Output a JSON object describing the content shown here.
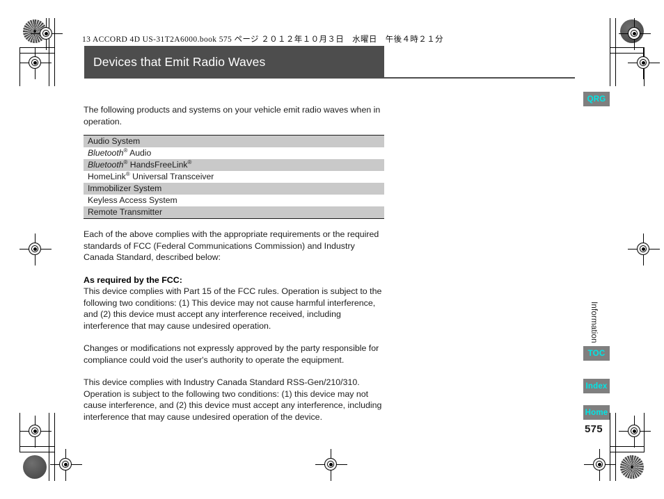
{
  "page": {
    "running_header": "13 ACCORD 4D US-31T2A6000.book  575 ページ  ２０１２年１０月３日　水曜日　午後４時２１分",
    "title": "Devices that Emit Radio Waves",
    "page_number": "575",
    "side_tab": "Information",
    "colors": {
      "title_bar": "#4d4d4d",
      "table_shade": "#c9c9c9",
      "nav_button_bg": "#7f7f7f",
      "nav_button_text": "#00e6e6"
    }
  },
  "body": {
    "intro": "The following products and systems on your vehicle emit radio waves when in operation.",
    "after_table": "Each of the above complies with the appropriate requirements or the required standards of FCC (Federal Communications Commission) and Industry Canada Standard, described below:",
    "fcc_heading": "As required by the FCC:",
    "fcc_para_1": "This device complies with Part 15 of the FCC rules. Operation is subject to the following two conditions: (1) This device may not cause harmful interference, and (2) this device must accept any interference received, including interference that may cause undesired operation.",
    "fcc_para_2": "Changes or modifications not expressly approved by the party responsible for compliance could void the user's authority to operate the equipment.",
    "ic_para": "This device complies with Industry Canada Standard RSS-Gen/210/310. Operation is subject to the following two conditions: (1) this device may not cause interference, and (2) this device must accept any interference, including interference that may cause undesired operation of the device."
  },
  "table": {
    "rows": [
      {
        "label": "Audio System",
        "shaded": true,
        "italic_prefix": ""
      },
      {
        "label": "Audio",
        "shaded": false,
        "italic_prefix": "Bluetooth"
      },
      {
        "label": "HandsFreeLink",
        "shaded": true,
        "italic_prefix": "Bluetooth"
      },
      {
        "label": "HomeLink",
        "shaded": false,
        "italic_prefix": ""
      },
      {
        "label": "Immobilizer System",
        "shaded": true,
        "italic_prefix": ""
      },
      {
        "label": "Keyless Access System",
        "shaded": false,
        "italic_prefix": ""
      },
      {
        "label": "Remote Transmitter",
        "shaded": true,
        "italic_prefix": ""
      }
    ],
    "row_1": "Audio System",
    "row_2_italic": "Bluetooth",
    "row_2_rest": " Audio",
    "row_3_italic": "Bluetooth",
    "row_3_mid": " HandsFreeLink",
    "row_4_a": "HomeLink",
    "row_4_b": " Universal Transceiver",
    "row_5": "Immobilizer System",
    "row_6": "Keyless Access System",
    "row_7": "Remote Transmitter",
    "registered_mark": "®"
  },
  "nav": {
    "qrg": "QRG",
    "toc": "TOC",
    "index": "Index",
    "home": "Home"
  }
}
